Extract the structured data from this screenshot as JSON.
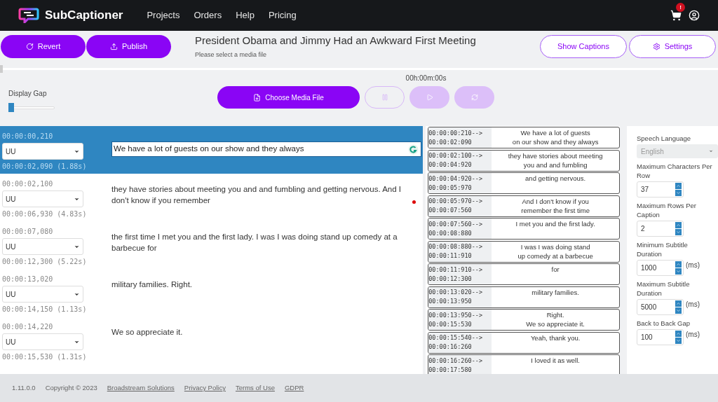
{
  "brand": "SubCaptioner",
  "nav": [
    "Projects",
    "Orders",
    "Help",
    "Pricing"
  ],
  "cart_badge": "!",
  "toolbar": {
    "left_buttons": [
      {
        "label": "Revert",
        "kind": "revert"
      },
      {
        "label": "Publish",
        "kind": "publish"
      }
    ],
    "title": "President Obama and Jimmy Had an Awkward First Meeting",
    "subtitle": "Please select a media file",
    "right_buttons": [
      {
        "label": "Show Captions",
        "kind": "plain"
      },
      {
        "label": "Settings",
        "kind": "settings"
      }
    ]
  },
  "timeline": {
    "level": 0
  },
  "player": {
    "time": "00h:00m:00s",
    "choose_label": "Choose Media File",
    "controls": [
      {
        "kind": "pause",
        "disabled": false
      },
      {
        "kind": "play",
        "disabled": true
      },
      {
        "kind": "refresh",
        "disabled": true
      }
    ]
  },
  "display_gap": {
    "label": "Display Gap",
    "level": 0
  },
  "segments": [
    {
      "start": "00:00:00,210",
      "speaker": "UU",
      "end": "00:00:02,090 (1.88s)",
      "text": "We have a lot of guests on our show and they always",
      "selected": true,
      "flagged": false
    },
    {
      "start": "00:00:02,100",
      "speaker": "UU",
      "end": "00:00:06,930 (4.83s)",
      "text": "they have stories about meeting you and and fumbling and getting nervous. And I don't know if you remember",
      "selected": false,
      "flagged": true
    },
    {
      "start": "00:00:07,080",
      "speaker": "UU",
      "end": "00:00:12,300 (5.22s)",
      "text": "the first time I met you and the first lady. I was I was doing stand up comedy at a barbecue for",
      "selected": false,
      "flagged": false
    },
    {
      "start": "00:00:13,020",
      "speaker": "UU",
      "end": "00:00:14,150 (1.13s)",
      "text": "military families. Right.",
      "selected": false,
      "flagged": false
    },
    {
      "start": "00:00:14,220",
      "speaker": "UU",
      "end": "00:00:15,530 (1.31s)",
      "text": "We so appreciate it.",
      "selected": false,
      "flagged": false
    }
  ],
  "captions": [
    {
      "start": "00:00:00:210-->",
      "end": "00:00:02:090",
      "lines": [
        "We have a lot of guests",
        "on our show and they always"
      ]
    },
    {
      "start": "00:00:02:100-->",
      "end": "00:00:04:920",
      "lines": [
        "they have stories about meeting",
        "you and and fumbling"
      ]
    },
    {
      "start": "00:00:04:920-->",
      "end": "00:00:05:970",
      "lines": [
        "and getting nervous."
      ]
    },
    {
      "start": "00:00:05:970-->",
      "end": "00:00:07:560",
      "lines": [
        "And I don't know if you",
        "remember the first time"
      ]
    },
    {
      "start": "00:00:07:560-->",
      "end": "00:00:08:880",
      "lines": [
        "I met you and the first lady."
      ]
    },
    {
      "start": "00:00:08:880-->",
      "end": "00:00:11:910",
      "lines": [
        "I was I was doing stand",
        "up comedy at a barbecue"
      ]
    },
    {
      "start": "00:00:11:910-->",
      "end": "00:00:12:300",
      "lines": [
        "for"
      ]
    },
    {
      "start": "00:00:13:020-->",
      "end": "00:00:13:950",
      "lines": [
        "military families."
      ]
    },
    {
      "start": "00:00:13:950-->",
      "end": "00:00:15:530",
      "lines": [
        "Right.",
        "We so appreciate it."
      ]
    },
    {
      "start": "00:00:15:540-->",
      "end": "00:00:16:260",
      "lines": [
        "Yeah, thank you."
      ]
    },
    {
      "start": "00:00:16:260-->",
      "end": "00:00:17:580",
      "lines": [
        "I loved it as well."
      ]
    }
  ],
  "settings": [
    {
      "kind": "select",
      "label": "Speech Language",
      "value": "English",
      "disabled": true
    },
    {
      "kind": "number",
      "label": "Maximum Characters Per Row",
      "value": "37"
    },
    {
      "kind": "number",
      "label": "Maximum Rows Per Caption",
      "value": "2"
    },
    {
      "kind": "number",
      "label": "Minimum Subtitle Duration",
      "value": "1000",
      "unit": "(ms)"
    },
    {
      "kind": "number",
      "label": "Maximum Subtitle Duration",
      "value": "5000",
      "unit": "(ms)"
    },
    {
      "kind": "number",
      "label": "Back to Back Gap",
      "value": "100",
      "unit": "(ms)"
    }
  ],
  "footer": {
    "version": "1.11.0.0",
    "copyright": "Copyright © 2023",
    "links": [
      "Broadstream Solutions",
      "Privacy Policy",
      "Terms of Use",
      "GDPR"
    ]
  }
}
